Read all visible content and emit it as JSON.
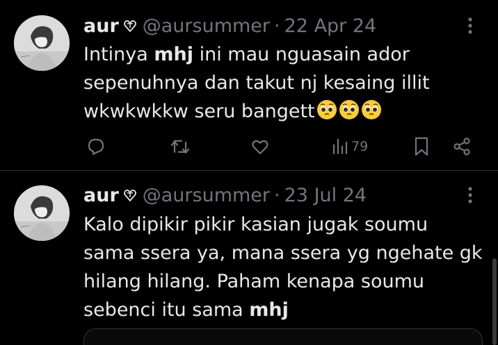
{
  "tweets": [
    {
      "display_name": "aur",
      "handle": "@aursummer",
      "separator": "·",
      "date": "22 Apr 24",
      "body": {
        "line1_pre": "Intinya ",
        "line1_bold": "mhj",
        "line1_post": " ini mau nguasain ador",
        "line2": "sepenuhnya dan takut nj kesaing illit",
        "line3": "wkwkwkkw seru bangett"
      },
      "emojis": [
        "pleading-face",
        "pleading-face",
        "pleading-face"
      ],
      "views": "79",
      "actions": [
        "reply-icon",
        "retweet-icon",
        "like-icon",
        "views-icon",
        "bookmark-icon",
        "share-icon"
      ]
    },
    {
      "display_name": "aur",
      "handle": "@aursummer",
      "separator": "·",
      "date": "23 Jul 24",
      "body": {
        "line1": "Kalo dipikir pikir kasian jugak soumu",
        "line2": "sama ssera ya, mana ssera yg ngehate gk",
        "line3": "hilang hilang. Paham kenapa soumu",
        "line4_pre": "sebenci itu sama ",
        "line4_bold": "mhj"
      }
    }
  ],
  "colors": {
    "background": "#000000",
    "text": "#e7e9ea",
    "secondary": "#71767b",
    "divider": "#2f3336"
  }
}
